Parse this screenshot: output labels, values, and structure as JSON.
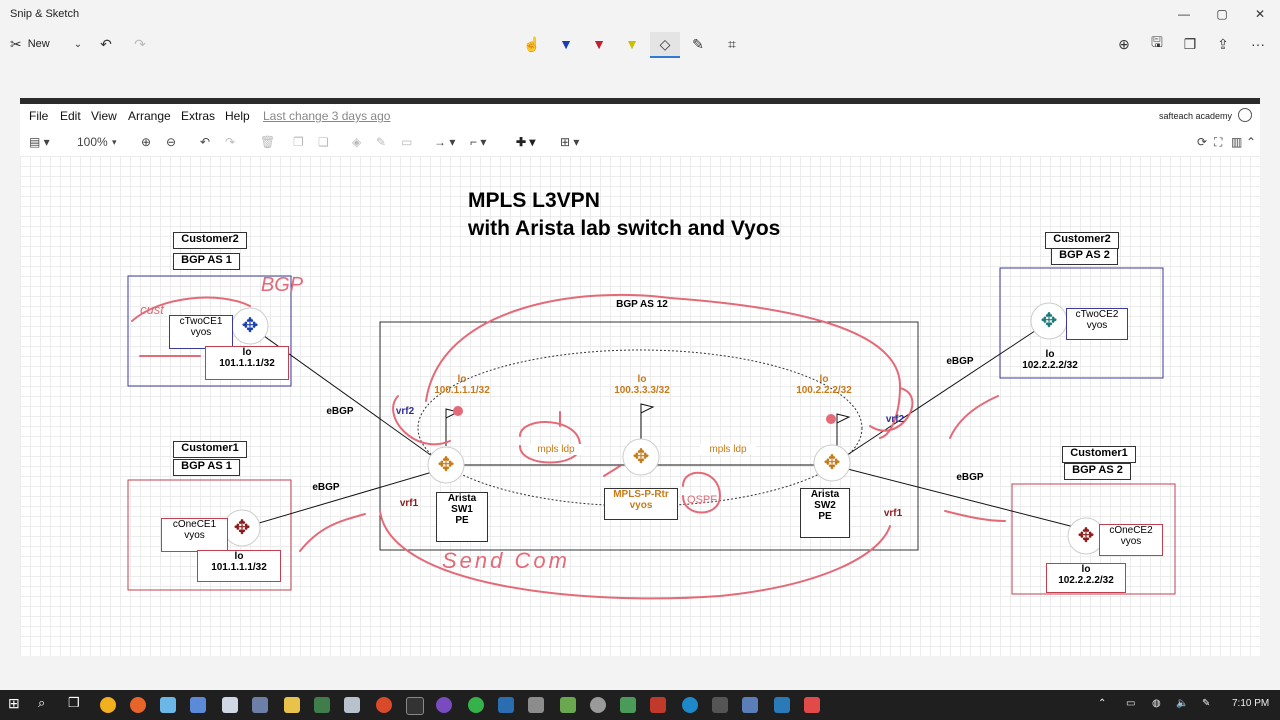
{
  "window": {
    "title": "Snip & Sketch"
  },
  "snip_toolbar": {
    "new_label": "New",
    "tools": [
      "touch-writing-icon",
      "ballpoint-pen-icon",
      "pencil-icon",
      "highlighter-icon",
      "eraser-icon",
      "ruler-icon",
      "crop-icon"
    ],
    "active_tool": "eraser-icon",
    "right_tools": [
      "zoom-icon",
      "save-icon",
      "copy-icon",
      "share-icon",
      "more-icon"
    ]
  },
  "drawio": {
    "menu": [
      "File",
      "Edit",
      "View",
      "Arrange",
      "Extras",
      "Help"
    ],
    "last_change": "Last change 3 days ago",
    "account": "safteach academy",
    "zoom": "100%"
  },
  "diagram": {
    "title_line1": "MPLS L3VPN",
    "title_line2": "with Arista lab switch and Vyos",
    "bgp_as12": "BGP AS 12",
    "left_c2": {
      "customer": "Customer2",
      "as": "BGP AS 1",
      "router": "cTwoCE1\nvyos",
      "lo": "lo",
      "lo_ip": "101.1.1.1/32"
    },
    "left_c1": {
      "customer": "Customer1",
      "as": "BGP AS 1",
      "router": "cOneCE1\nvyos",
      "lo": "lo",
      "lo_ip": "101.1.1.1/32"
    },
    "right_c2": {
      "customer": "Customer2",
      "as": "BGP AS 2",
      "router": "cTwoCE2\nvyos",
      "lo": "lo",
      "lo_ip": "102.2.2.2/32"
    },
    "right_c1": {
      "customer": "Customer1",
      "as": "BGP AS 2",
      "router": "cOneCE2\nvyos",
      "lo": "lo",
      "lo_ip": "102.2.2.2/32"
    },
    "sw1": {
      "name": "Arista\nSW1\nPE",
      "lo": "lo",
      "lo_ip": "100.1.1.1/32"
    },
    "sw2": {
      "name": "Arista\nSW2\nPE",
      "lo": "lo",
      "lo_ip": "100.2.2.2/32"
    },
    "prtr": {
      "name": "MPLS-P-Rtr\nvyos",
      "lo": "lo",
      "lo_ip": "100.3.3.3/32"
    },
    "ldp1": "mpls ldp",
    "ldp2": "mpls ldp",
    "ebgp": "eBGP",
    "vrf1": "vrf1",
    "vrf2": "vrf2"
  },
  "ink": {
    "ospf": "OSPF",
    "send": "Send Com",
    "bgp": "BGP",
    "cust": "cust"
  },
  "taskbar": {
    "time": "7:10 PM"
  },
  "colors": {
    "accent": "#2d7bd6",
    "ink": "#e05a6a",
    "orange": "#c87a1a",
    "navy": "#2f2f9a",
    "darkred": "#8b1a1a"
  }
}
